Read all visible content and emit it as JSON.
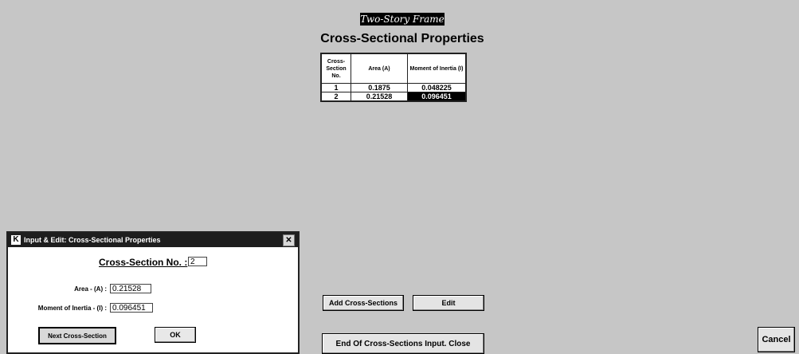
{
  "window": {
    "frame_title": "Two-Story Frame",
    "page_title": "Cross-Sectional Properties"
  },
  "table": {
    "headers": [
      "Cross-Section No.",
      "Area (A)",
      "Moment of Inertia (I)"
    ],
    "rows": [
      [
        "1",
        "0.1875",
        "0.048225"
      ],
      [
        "2",
        "0.21528",
        "0.096451"
      ]
    ],
    "selected_cell": "row 2, Moment of Inertia (I)"
  },
  "buttons": {
    "add": "Add Cross-Sections",
    "edit": "Edit",
    "end": "End Of Cross-Sections Input. Close",
    "cancel": "Cancel"
  },
  "dialog": {
    "title": "Input & Edit: Cross-Sectional Properties",
    "logo_letter": "K",
    "close_glyph": "✕",
    "cs_no_label": "Cross-Section No. :",
    "cs_no_value": "2",
    "area_label": "Area - (A) :",
    "area_value": "0.21528",
    "moi_label": "Moment of Inertia - (I) :",
    "moi_value": "0.096451",
    "next_label": "Next Cross-Section",
    "ok_label": "OK"
  },
  "icons": {
    "logo": "app-logo-icon",
    "close": "close-icon"
  },
  "colors": {
    "background": "#c6c6c6",
    "titlebar": "#1e1e1e",
    "selected_cell": "#000000"
  }
}
